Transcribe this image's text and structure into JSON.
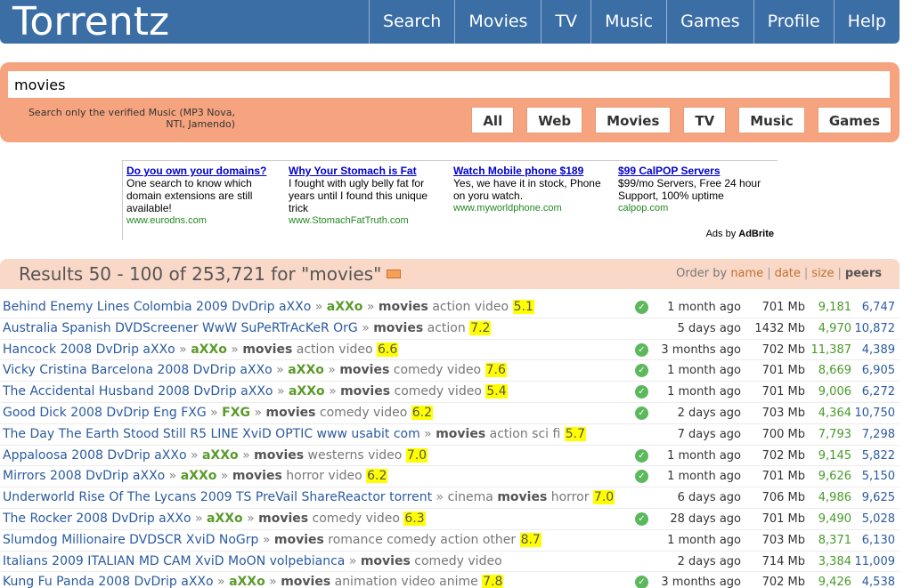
{
  "app": {
    "logo": "Torrentz"
  },
  "nav": [
    "Search",
    "Movies",
    "TV",
    "Music",
    "Games",
    "Profile",
    "Help"
  ],
  "search": {
    "value": "movies",
    "verified_note": "Search only the verified Music (MP3 Nova, NTI, Jamendo)",
    "filters": [
      "All",
      "Web",
      "Movies",
      "TV",
      "Music",
      "Games"
    ]
  },
  "ads": {
    "items": [
      {
        "title": "Do you own your domains?",
        "body": "One search to know which domain extensions are still available!",
        "url": "www.eurodns.com"
      },
      {
        "title": "Why Your Stomach is Fat",
        "body": "I fought with ugly belly fat for years until I found this unique trick",
        "url": "www.StomachFatTruth.com"
      },
      {
        "title": "Watch Mobile phone $189",
        "body": "Yes, we have it in stock, Phone on yoru watch.",
        "url": "www.myworldphone.com"
      },
      {
        "title": "$99 CalPOP Servers",
        "body": "$99/mo Servers, Free 24 hour Support, 100% uptime",
        "url": "calpop.com"
      }
    ],
    "ads_by_prefix": "Ads by",
    "ads_by_brand": "AdBrite"
  },
  "results": {
    "title": "Results 50 - 100 of 253,721 for \"movies\"",
    "order_by_label": "Order by",
    "order_options": [
      "name",
      "date",
      "size",
      "peers"
    ],
    "rows": [
      {
        "name": "Behind Enemy Lines Colombia 2009 DvDrip aXXo",
        "user": "aXXo",
        "cat": "movies",
        "tags": "action video",
        "rating": "5.1",
        "verified": true,
        "age": "1 month ago",
        "size": "701 Mb",
        "seeds": "9,181",
        "peers": "6,747"
      },
      {
        "name": "Australia Spanish DVDScreener WwW SuPeRTrAcKeR OrG",
        "user": "",
        "cat": "movies",
        "tags": "action",
        "rating": "7.2",
        "verified": false,
        "age": "5 days ago",
        "size": "1432 Mb",
        "seeds": "4,970",
        "peers": "10,872"
      },
      {
        "name": "Hancock 2008 DvDrip aXXo",
        "user": "aXXo",
        "cat": "movies",
        "tags": "action video",
        "rating": "6.6",
        "verified": true,
        "age": "3 months ago",
        "size": "702 Mb",
        "seeds": "11,387",
        "peers": "4,389"
      },
      {
        "name": "Vicky Cristina Barcelona 2008 DvDrip aXXo",
        "user": "aXXo",
        "cat": "movies",
        "tags": "comedy video",
        "rating": "7.6",
        "verified": true,
        "age": "1 month ago",
        "size": "701 Mb",
        "seeds": "8,669",
        "peers": "6,905"
      },
      {
        "name": "The Accidental Husband 2008 DvDrip aXXo",
        "user": "aXXo",
        "cat": "movies",
        "tags": "comedy video",
        "rating": "5.4",
        "verified": true,
        "age": "1 month ago",
        "size": "701 Mb",
        "seeds": "9,006",
        "peers": "6,272"
      },
      {
        "name": "Good Dick 2008 DvDrip Eng FXG",
        "user": "FXG",
        "cat": "movies",
        "tags": "comedy video",
        "rating": "6.2",
        "verified": true,
        "age": "2 days ago",
        "size": "703 Mb",
        "seeds": "4,364",
        "peers": "10,750"
      },
      {
        "name": "The Day The Earth Stood Still R5 LINE XviD OPTIC www usabit com",
        "user": "",
        "cat": "movies",
        "tags": "action sci fi",
        "rating": "5.7",
        "verified": false,
        "age": "7 days ago",
        "size": "700 Mb",
        "seeds": "7,793",
        "peers": "7,298"
      },
      {
        "name": "Appaloosa 2008 DvDrip aXXo",
        "user": "aXXo",
        "cat": "movies",
        "tags": "westerns video",
        "rating": "7.0",
        "verified": true,
        "age": "1 month ago",
        "size": "702 Mb",
        "seeds": "9,145",
        "peers": "5,822"
      },
      {
        "name": "Mirrors 2008 DvDrip aXXo",
        "user": "aXXo",
        "cat": "movies",
        "tags": "horror video",
        "rating": "6.2",
        "verified": true,
        "age": "1 month ago",
        "size": "701 Mb",
        "seeds": "9,626",
        "peers": "5,150"
      },
      {
        "name": "Underworld Rise Of The Lycans 2009 TS PreVail ShareReactor torrent",
        "user": "",
        "pre": "cinema",
        "cat": "movies",
        "tags": "horror",
        "rating": "7.0",
        "verified": false,
        "age": "6 days ago",
        "size": "706 Mb",
        "seeds": "4,986",
        "peers": "9,625"
      },
      {
        "name": "The Rocker 2008 DvDrip aXXo",
        "user": "aXXo",
        "cat": "movies",
        "tags": "comedy video",
        "rating": "6.3",
        "verified": true,
        "age": "28 days ago",
        "size": "701 Mb",
        "seeds": "9,490",
        "peers": "5,028"
      },
      {
        "name": "Slumdog Millionaire DVDSCR XviD NoGrp",
        "user": "",
        "cat": "movies",
        "tags": "romance comedy action other",
        "rating": "8.7",
        "verified": false,
        "age": "1 month ago",
        "size": "703 Mb",
        "seeds": "8,371",
        "peers": "6,130"
      },
      {
        "name": "Italians 2009 ITALIAN MD CAM XviD MoON volpebianca",
        "user": "",
        "cat": "movies",
        "tags": "comedy video",
        "rating": "",
        "verified": false,
        "age": "2 days ago",
        "size": "714 Mb",
        "seeds": "3,384",
        "peers": "11,009"
      },
      {
        "name": "Kung Fu Panda 2008 DvDrip aXXo",
        "user": "aXXo",
        "cat": "movies",
        "tags": "animation video anime",
        "rating": "7.8",
        "verified": true,
        "age": "3 months ago",
        "size": "702 Mb",
        "seeds": "9,426",
        "peers": "4,538"
      }
    ]
  },
  "colors": {
    "header": "#3a6ea5",
    "search_panel": "#f6a47f",
    "results_bar": "#f9d8c8",
    "rating_highlight": "#ffff00"
  }
}
